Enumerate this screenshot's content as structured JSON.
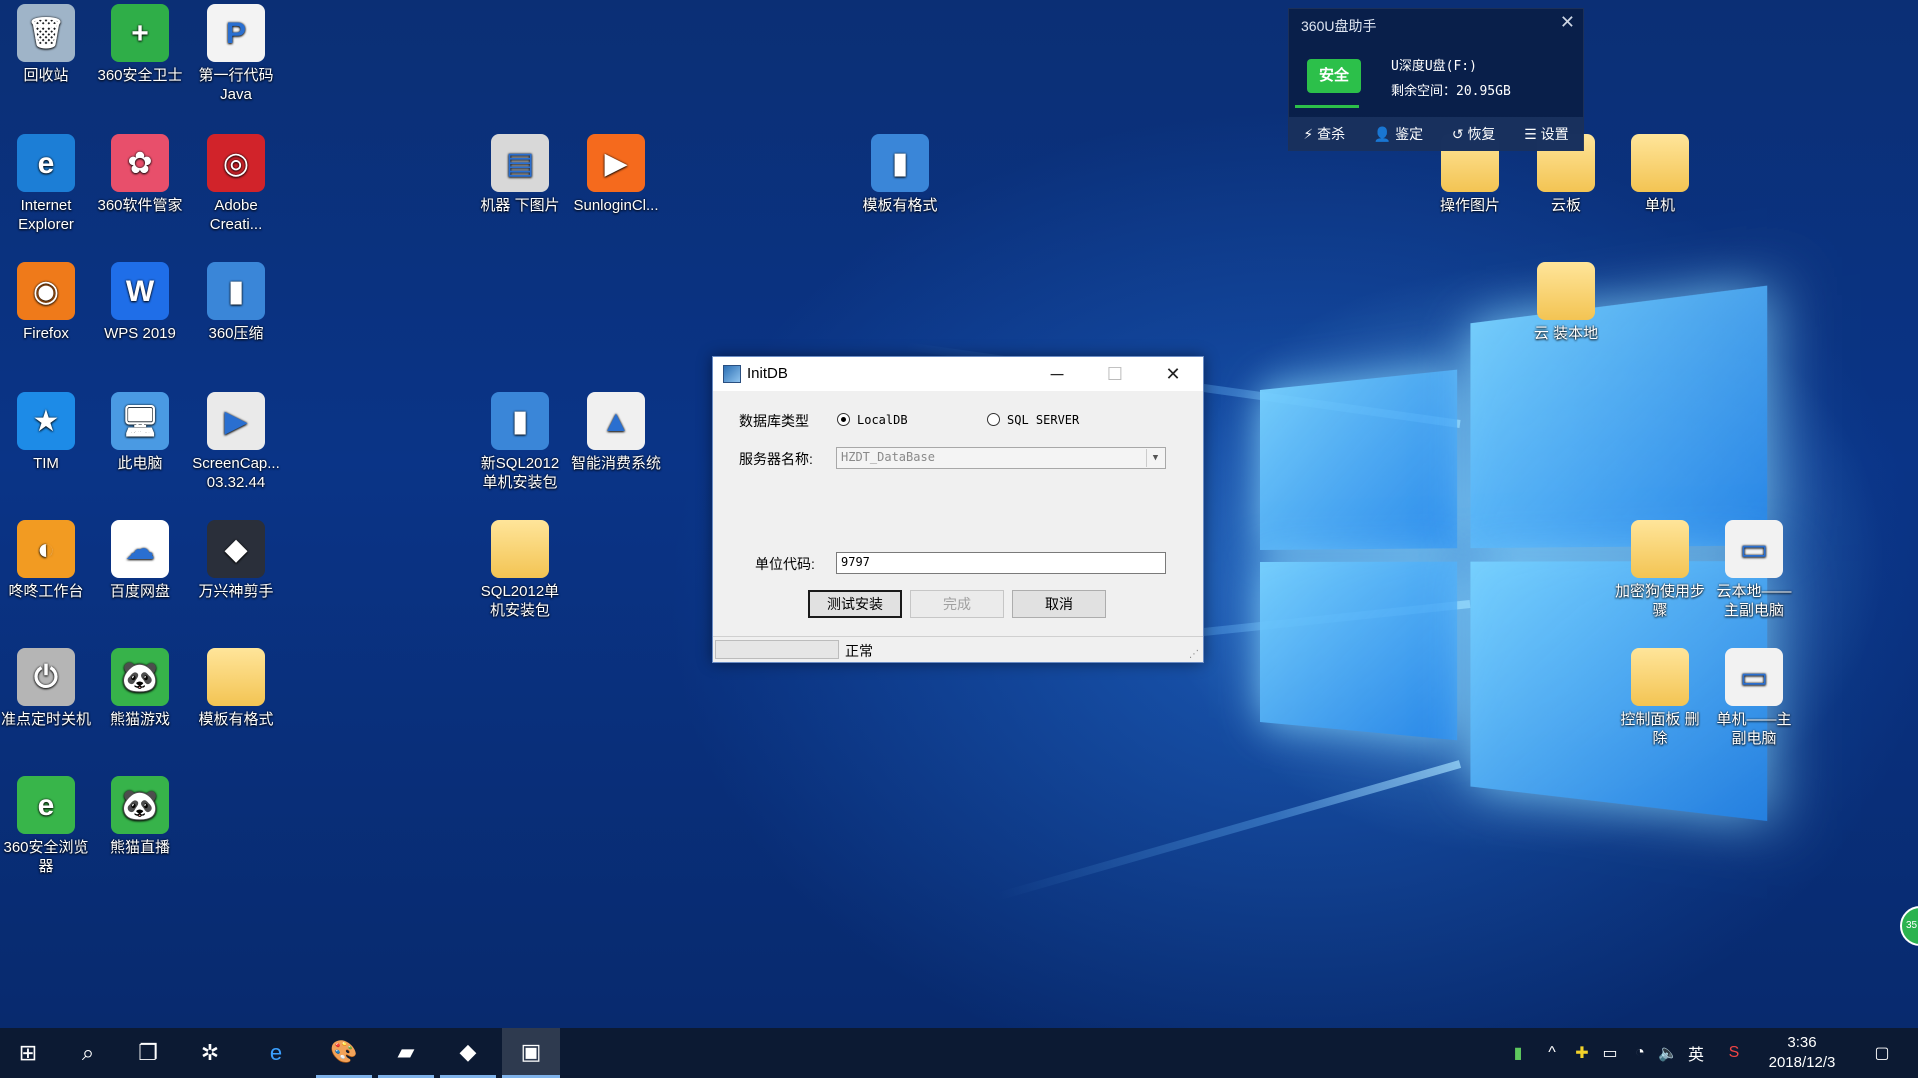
{
  "desktop": {
    "icons": [
      {
        "label": "回收站",
        "glyph": "🗑",
        "color": "#9fb4c8"
      },
      {
        "label": "360安全卫士",
        "glyph": "+",
        "color": "#2fae48"
      },
      {
        "label": "第一行代码\nJava",
        "glyph": "P",
        "color": "#f3f3f3"
      },
      {
        "label": "Internet\nExplorer",
        "glyph": "e",
        "color": "#1c7ed6"
      },
      {
        "label": "360软件管家",
        "glyph": "✿",
        "color": "#e84f6b"
      },
      {
        "label": "Adobe\nCreati...",
        "glyph": "◎",
        "color": "#d1232a"
      },
      {
        "label": "Firefox",
        "glyph": "◉",
        "color": "#ef7a1a"
      },
      {
        "label": "WPS 2019",
        "glyph": "W",
        "color": "#1f6ee8"
      },
      {
        "label": "360压缩",
        "glyph": "▮",
        "color": "#3a86d8"
      },
      {
        "label": "TIM",
        "glyph": "★",
        "color": "#1d8be7"
      },
      {
        "label": "此电脑",
        "glyph": "🖥",
        "color": "#4a9ae3"
      },
      {
        "label": "ScreenCap...\n03.32.44",
        "glyph": "▶",
        "color": "#eaeaea"
      },
      {
        "label": "咚咚工作台",
        "glyph": "◐",
        "color": "#f29b22"
      },
      {
        "label": "百度网盘",
        "glyph": "☁",
        "color": "#ffffff"
      },
      {
        "label": "万兴神剪手",
        "glyph": "◆",
        "color": "#2a2f3a"
      },
      {
        "label": "准点定时关机",
        "glyph": "⏻",
        "color": "#b5b5b5"
      },
      {
        "label": "熊猫游戏",
        "glyph": "🐼",
        "color": "#37b34a"
      },
      {
        "label": "模板有格式",
        "glyph": "",
        "color": "#f3c453"
      },
      {
        "label": "360安全浏览\n器",
        "glyph": "e",
        "color": "#38b54a"
      },
      {
        "label": "熊猫直播",
        "glyph": "🐼",
        "color": "#37b34a"
      },
      {
        "label": "机器 下图片",
        "glyph": "▤",
        "color": "#d8d8d8"
      },
      {
        "label": "SunloginCl...",
        "glyph": "▶",
        "color": "#f56a1d"
      },
      {
        "label": "模板有格式",
        "glyph": "▮",
        "color": "#3a86d8"
      },
      {
        "label": "新SQL2012\n单机安装包",
        "glyph": "▮",
        "color": "#3a86d8"
      },
      {
        "label": "智能消费系统",
        "glyph": "▲",
        "color": "#f0f0f0"
      },
      {
        "label": "SQL2012单\n机安装包",
        "glyph": "",
        "color": "#f3c453"
      },
      {
        "label": "操作图片",
        "glyph": "",
        "color": "#f3c453"
      },
      {
        "label": "云板",
        "glyph": "",
        "color": "#f3c453"
      },
      {
        "label": "单机",
        "glyph": "",
        "color": "#f3c453"
      },
      {
        "label": "云 装本地",
        "glyph": "",
        "color": "#f3c453"
      },
      {
        "label": "加密狗使用步\n骤",
        "glyph": "",
        "color": "#f3c453"
      },
      {
        "label": "云本地——\n主副电脑",
        "glyph": "▭",
        "color": "#f2f2f2"
      },
      {
        "label": "控制面板 删\n除",
        "glyph": "",
        "color": "#f3c453"
      },
      {
        "label": "单机——主\n副电脑",
        "glyph": "▭",
        "color": "#f2f2f2"
      }
    ]
  },
  "usb_popup": {
    "title": "360U盘助手",
    "safe_label": "安全",
    "drive_name": "U深度U盘(F:)",
    "free_space": "剩余空间：20.95GB",
    "actions": [
      "查杀",
      "鉴定",
      "恢复",
      "设置"
    ],
    "close": "✕"
  },
  "dialog": {
    "title": "InitDB",
    "db_type_label": "数据库类型",
    "radio_localdb": "LocalDB",
    "radio_sqlserver": "SQL SERVER",
    "server_label": "服务器名称:",
    "server_value": "HZDT_DataBase",
    "unit_label": "单位代码:",
    "unit_value": "9797",
    "btn_test": "测试安装",
    "btn_finish": "完成",
    "btn_cancel": "取消",
    "status": "正常",
    "minimize": "─",
    "maximize": "☐",
    "close": "✕"
  },
  "taskbar": {
    "time": "3:36",
    "date": "2018/12/3",
    "ime": "英",
    "float_ball": "35"
  }
}
